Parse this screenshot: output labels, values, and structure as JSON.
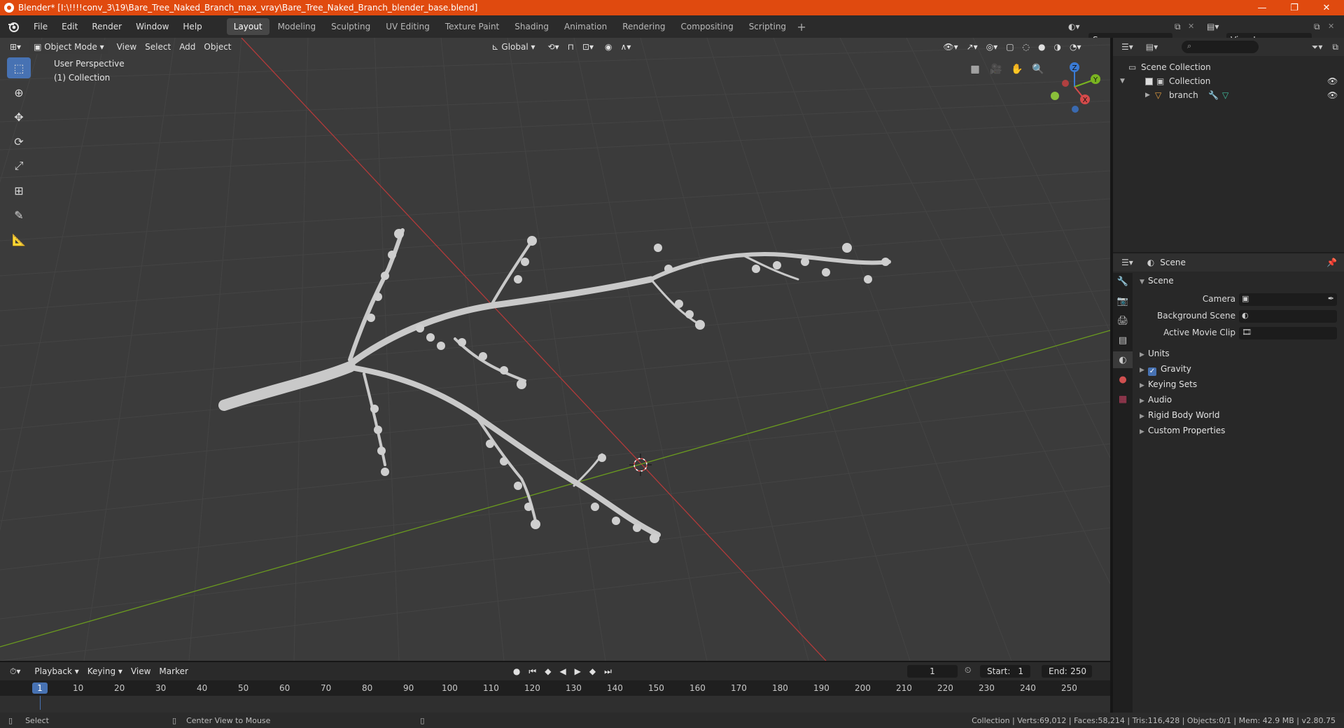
{
  "titlebar": {
    "title": "Blender* [I:\\!!!!conv_3\\19\\Bare_Tree_Naked_Branch_max_vray\\Bare_Tree_Naked_Branch_blender_base.blend]",
    "minimize": "—",
    "maximize": "❐",
    "close": "✕"
  },
  "menubar": {
    "menus": [
      "File",
      "Edit",
      "Render",
      "Window",
      "Help"
    ],
    "workspaces": [
      "Layout",
      "Modeling",
      "Sculpting",
      "UV Editing",
      "Texture Paint",
      "Shading",
      "Animation",
      "Rendering",
      "Compositing",
      "Scripting"
    ],
    "active_workspace": "Layout",
    "add_workspace": "+",
    "scene": "Scene",
    "view_layer": "View Layer"
  },
  "viewport": {
    "mode": "Object Mode",
    "menus": [
      "View",
      "Select",
      "Add",
      "Object"
    ],
    "orientation": "Global",
    "perspective": "User Perspective",
    "collection": "(1) Collection",
    "gizmo": {
      "z": "Z",
      "y": "Y",
      "x": "X"
    }
  },
  "outliner": {
    "root": "Scene Collection",
    "collection": "Collection",
    "object": "branch"
  },
  "properties": {
    "context": "Scene",
    "panel": "Scene",
    "fields": [
      {
        "label": "Camera"
      },
      {
        "label": "Background Scene"
      },
      {
        "label": "Active Movie Clip"
      }
    ],
    "sections": [
      "Units",
      "Gravity",
      "Keying Sets",
      "Audio",
      "Rigid Body World",
      "Custom Properties"
    ],
    "gravity_checked": true
  },
  "timeline": {
    "menus": [
      "Playback",
      "Keying",
      "View",
      "Marker"
    ],
    "current_frame": "1",
    "start_label": "Start:",
    "start": "1",
    "end_label": "End:",
    "end": "250",
    "ruler": [
      "10",
      "20",
      "30",
      "40",
      "50",
      "60",
      "70",
      "80",
      "90",
      "100",
      "110",
      "120",
      "130",
      "140",
      "150",
      "160",
      "170",
      "180",
      "190",
      "200",
      "210",
      "220",
      "230",
      "240",
      "250"
    ],
    "cursor_frame": "1"
  },
  "statusbar": {
    "left_action": "Select",
    "middle_action": "Center View to Mouse",
    "stats": "Collection | Verts:69,012 | Faces:58,214 | Tris:116,428 | Objects:0/1 | Mem: 42.9 MB | v2.80.75"
  },
  "colors": {
    "titlebar": "#e04a0f",
    "accent": "#4772b3",
    "x_axis": "#b33a3a",
    "y_axis": "#6a9a1f",
    "viewport_bg": "#3b3b3b"
  }
}
